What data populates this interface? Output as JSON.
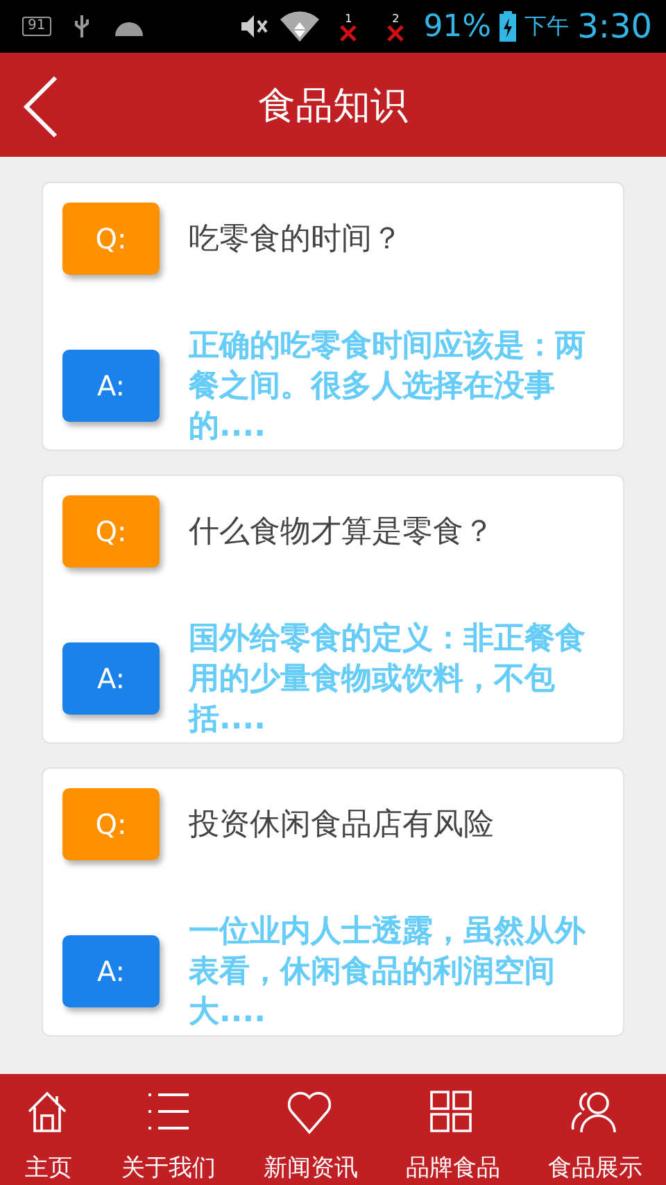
{
  "status_bar": {
    "notification_badge": "91",
    "sim_1": "1",
    "sim_2": "2",
    "battery": "91%",
    "period": "下午",
    "time": "3:30"
  },
  "header": {
    "title": "食品知识"
  },
  "questions": [
    {
      "q_label": "Q:",
      "question": "吃零食的时间？",
      "a_label": "A:",
      "answer": "正确的吃零食时间应该是：两餐之间。很多人选择在没事的...."
    },
    {
      "q_label": "Q:",
      "question": "什么食物才算是零食？",
      "a_label": "A:",
      "answer": "国外给零食的定义：非正餐食用的少量食物或饮料，不包括...."
    },
    {
      "q_label": "Q:",
      "question": "投资休闲食品店有风险",
      "a_label": "A:",
      "answer": "一位业内人士透露，虽然从外表看，休闲食品的利润空间大...."
    }
  ],
  "bottom_nav": [
    {
      "kind": "home",
      "label": "主页"
    },
    {
      "kind": "list",
      "label": "关于我们"
    },
    {
      "kind": "heart",
      "label": "新闻资讯"
    },
    {
      "kind": "grid",
      "label": "品牌食品"
    },
    {
      "kind": "people",
      "label": "食品展示"
    }
  ]
}
